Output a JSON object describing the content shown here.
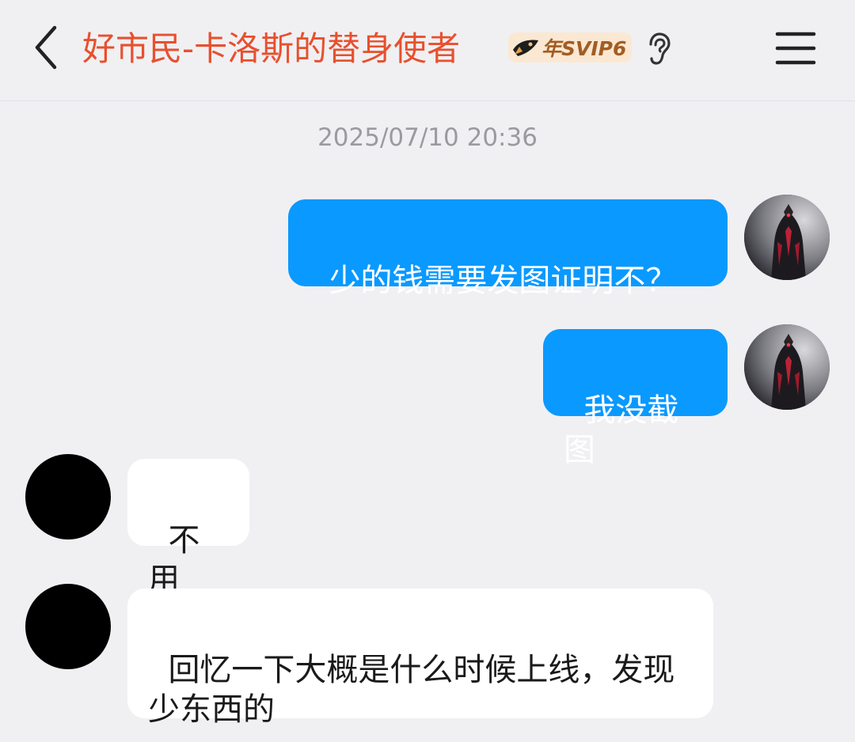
{
  "header": {
    "title": "好市民-卡洛斯的替身使者",
    "vip_badge": "年SVIP6",
    "icons": {
      "back": "chevron-left-icon",
      "badge": "svip-rocket-icon",
      "ear": "ear-icon",
      "menu": "hamburger-menu-icon"
    },
    "title_color": "#e8502d"
  },
  "chat": {
    "timestamp": "2025/07/10 20:36",
    "messages": [
      {
        "direction": "outgoing",
        "text": "少的钱需要发图证明不？"
      },
      {
        "direction": "outgoing",
        "text": "我没截图"
      },
      {
        "direction": "incoming",
        "text": "不用"
      },
      {
        "direction": "incoming",
        "text": "回忆一下大概是什么时候上线，发现少东西的"
      }
    ]
  },
  "colors": {
    "outgoing_bubble": "#0a99ff",
    "incoming_bubble": "#ffffff",
    "background": "#f0f0f3"
  }
}
